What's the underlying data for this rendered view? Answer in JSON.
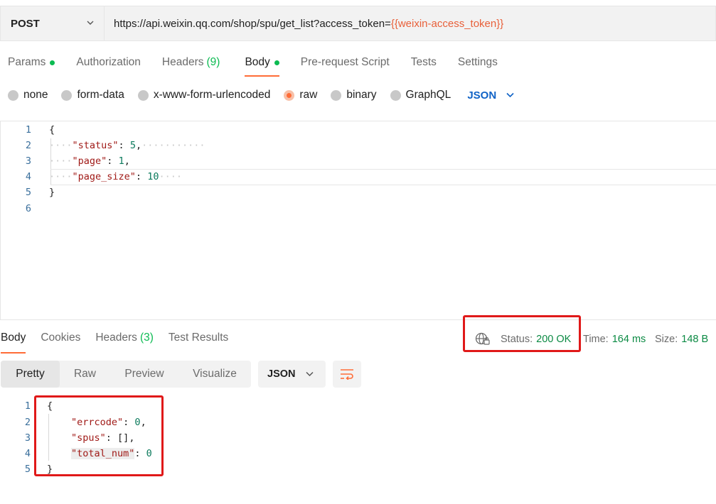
{
  "request": {
    "method": "POST",
    "url_prefix": "https://api.weixin.qq.com/shop/spu/get_list?access_token=",
    "url_variable": "{{weixin-access_token}}"
  },
  "request_tabs": [
    {
      "label": "Params",
      "dot": true
    },
    {
      "label": "Authorization"
    },
    {
      "label": "Headers",
      "count": "(9)"
    },
    {
      "label": "Body",
      "dot": true,
      "active": true
    },
    {
      "label": "Pre-request Script"
    },
    {
      "label": "Tests"
    },
    {
      "label": "Settings"
    }
  ],
  "body_types": [
    "none",
    "form-data",
    "x-www-form-urlencoded",
    "raw",
    "binary",
    "GraphQL"
  ],
  "body_type_selected": "raw",
  "body_language": "JSON",
  "request_body": {
    "line_numbers": [
      "1",
      "2",
      "3",
      "4",
      "5",
      "6"
    ],
    "open_brace": "{",
    "close_brace": "}",
    "fields": [
      {
        "key": "\"status\"",
        "value": "5"
      },
      {
        "key": "\"page\"",
        "value": "1"
      },
      {
        "key": "\"page_size\"",
        "value": "10"
      }
    ]
  },
  "response_tabs": [
    {
      "label": "Body",
      "active": true
    },
    {
      "label": "Cookies"
    },
    {
      "label": "Headers",
      "count": "(3)"
    },
    {
      "label": "Test Results"
    }
  ],
  "response_status": {
    "status_label": "Status:",
    "status_value": "200 OK",
    "time_label": "Time:",
    "time_value": "164 ms",
    "size_label": "Size:",
    "size_value": "148 B"
  },
  "view_modes": [
    "Pretty",
    "Raw",
    "Preview",
    "Visualize"
  ],
  "view_mode_selected": "Pretty",
  "response_format": "JSON",
  "response_body": {
    "line_numbers": [
      "1",
      "2",
      "3",
      "4",
      "5"
    ],
    "open_brace": "{",
    "close_brace": "}",
    "fields": [
      {
        "key": "\"errcode\"",
        "value": "0"
      },
      {
        "key": "\"spus\"",
        "value": "[]"
      },
      {
        "key": "\"total_num\"",
        "value": "0"
      }
    ]
  },
  "colors": {
    "accent": "#ff6c37",
    "success": "#0cbb52",
    "link": "#0f62c6",
    "annotation_box": "#e01919"
  }
}
